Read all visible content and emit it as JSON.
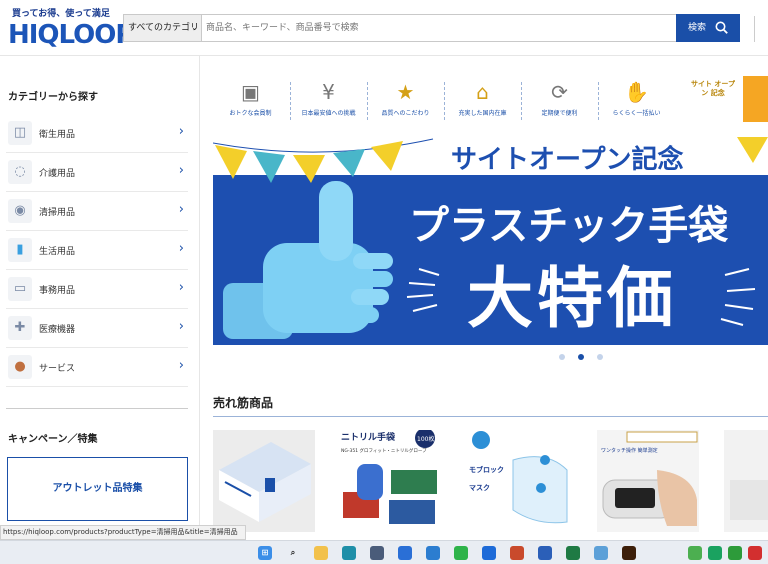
{
  "header": {
    "logo_tagline": "買ってお得、使って満足",
    "logo_text": "HIQLOOP",
    "category_select": "すべてのカテゴリ",
    "search_placeholder": "商品名、キーワード、商品番号で検索",
    "search_button": "検索"
  },
  "sidebar": {
    "title": "カテゴリーから探す",
    "items": [
      {
        "label": "衛生用品",
        "icon": "mask-icon"
      },
      {
        "label": "介護用品",
        "icon": "care-icon"
      },
      {
        "label": "清掃用品",
        "icon": "spray-icon"
      },
      {
        "label": "生活用品",
        "icon": "bottle-icon"
      },
      {
        "label": "事務用品",
        "icon": "computer-icon"
      },
      {
        "label": "医療機器",
        "icon": "medical-icon"
      },
      {
        "label": "サービス",
        "icon": "person-icon"
      }
    ],
    "campaign_title": "キャンペーン／特集",
    "outlet_label": "アウトレット品特集"
  },
  "features": [
    {
      "label": "おトクな会員制",
      "icon": "member-card-icon"
    },
    {
      "label": "日本最安値への挑戦",
      "icon": "yen-icon"
    },
    {
      "label": "品質へのこだわり",
      "icon": "medal-icon"
    },
    {
      "label": "充実した国内在庫",
      "icon": "warehouse-icon"
    },
    {
      "label": "定期便で便利",
      "icon": "truck-icon"
    },
    {
      "label": "らくらく一括払い",
      "icon": "coins-hand-icon"
    }
  ],
  "anniversary_badge": "サイト オープン 記念",
  "banner": {
    "line1": "サイトオープン記念",
    "line2": "プラスチック手袋",
    "line3": "大特価"
  },
  "carousel": {
    "count": 3,
    "active_index": 1
  },
  "bestsellers": {
    "title": "売れ筋商品",
    "products": [
      {
        "kind": "glove-box"
      },
      {
        "kind": "nitrile-gloves",
        "title": "ニトリル手袋",
        "badge": "100枚入",
        "subtitle": "NG-351 グロフィット・ニトリルグローブ"
      },
      {
        "kind": "mask",
        "text1": "モブロック",
        "text2": "マスク"
      },
      {
        "kind": "oximeter",
        "text": "ワンタッチ操作 簡単測定"
      }
    ]
  },
  "status_url": "https://hiqloop.com/products?productType=清掃用品&title=清掃用品",
  "colors": {
    "brand": "#1a4fa8",
    "banner": "#1d4fb0",
    "accent": "#f5a623"
  }
}
